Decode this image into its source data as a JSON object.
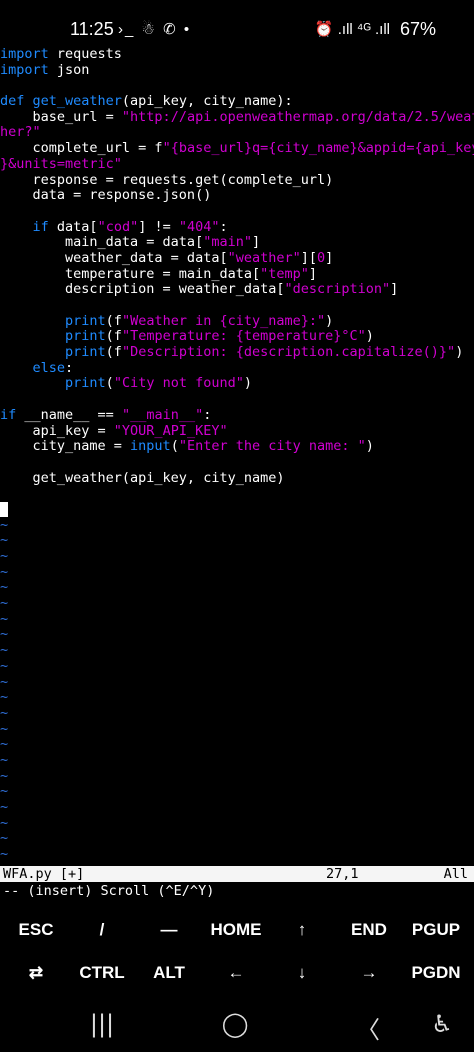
{
  "status_bar": {
    "time": "11:25",
    "left_icons": "›_ ☃ ✆ •",
    "right_icons": "⏰ .ıll ⁴ᴳ .ıll",
    "battery": "67%"
  },
  "code_lines": [
    [
      {
        "c": "kw",
        "t": "import"
      },
      {
        "c": "pl",
        "t": " requests"
      }
    ],
    [
      {
        "c": "kw",
        "t": "import"
      },
      {
        "c": "pl",
        "t": " json"
      }
    ],
    [],
    [
      {
        "c": "kw",
        "t": "def "
      },
      {
        "c": "fn",
        "t": "get_weather"
      },
      {
        "c": "pl",
        "t": "(api_key, city_name):"
      }
    ],
    [
      {
        "c": "pl",
        "t": "    base_url = "
      },
      {
        "c": "str",
        "t": "\"http://api.openweathermap.org/data/2.5/weat"
      }
    ],
    [
      {
        "c": "str",
        "t": "her?\""
      }
    ],
    [
      {
        "c": "pl",
        "t": "    complete_url = f"
      },
      {
        "c": "str",
        "t": "\"{base_url}q={city_name}&appid={api_key"
      }
    ],
    [
      {
        "c": "str",
        "t": "}&units=metric\""
      }
    ],
    [
      {
        "c": "pl",
        "t": "    response = requests.get(complete_url)"
      }
    ],
    [
      {
        "c": "pl",
        "t": "    data = response.json()"
      }
    ],
    [],
    [
      {
        "c": "pl",
        "t": "    "
      },
      {
        "c": "kw",
        "t": "if"
      },
      {
        "c": "pl",
        "t": " data["
      },
      {
        "c": "str",
        "t": "\"cod\""
      },
      {
        "c": "pl",
        "t": "] != "
      },
      {
        "c": "str",
        "t": "\"404\""
      },
      {
        "c": "pl",
        "t": ":"
      }
    ],
    [
      {
        "c": "pl",
        "t": "        main_data = data["
      },
      {
        "c": "str",
        "t": "\"main\""
      },
      {
        "c": "pl",
        "t": "]"
      }
    ],
    [
      {
        "c": "pl",
        "t": "        weather_data = data["
      },
      {
        "c": "str",
        "t": "\"weather\""
      },
      {
        "c": "pl",
        "t": "]["
      },
      {
        "c": "str",
        "t": "0"
      },
      {
        "c": "pl",
        "t": "]"
      }
    ],
    [
      {
        "c": "pl",
        "t": "        temperature = main_data["
      },
      {
        "c": "str",
        "t": "\"temp\""
      },
      {
        "c": "pl",
        "t": "]"
      }
    ],
    [
      {
        "c": "pl",
        "t": "        description = weather_data["
      },
      {
        "c": "str",
        "t": "\"description\""
      },
      {
        "c": "pl",
        "t": "]"
      }
    ],
    [],
    [
      {
        "c": "pl",
        "t": "        "
      },
      {
        "c": "fn",
        "t": "print"
      },
      {
        "c": "pl",
        "t": "(f"
      },
      {
        "c": "str",
        "t": "\"Weather in {city_name}:\""
      },
      {
        "c": "pl",
        "t": ")"
      }
    ],
    [
      {
        "c": "pl",
        "t": "        "
      },
      {
        "c": "fn",
        "t": "print"
      },
      {
        "c": "pl",
        "t": "(f"
      },
      {
        "c": "str",
        "t": "\"Temperature: {temperature}°C\""
      },
      {
        "c": "pl",
        "t": ")"
      }
    ],
    [
      {
        "c": "pl",
        "t": "        "
      },
      {
        "c": "fn",
        "t": "print"
      },
      {
        "c": "pl",
        "t": "(f"
      },
      {
        "c": "str",
        "t": "\"Description: {description.capitalize()}\""
      },
      {
        "c": "pl",
        "t": ")"
      }
    ],
    [
      {
        "c": "pl",
        "t": "    "
      },
      {
        "c": "kw",
        "t": "else"
      },
      {
        "c": "pl",
        "t": ":"
      }
    ],
    [
      {
        "c": "pl",
        "t": "        "
      },
      {
        "c": "fn",
        "t": "print"
      },
      {
        "c": "pl",
        "t": "("
      },
      {
        "c": "str",
        "t": "\"City not found\""
      },
      {
        "c": "pl",
        "t": ")"
      }
    ],
    [],
    [
      {
        "c": "kw",
        "t": "if"
      },
      {
        "c": "pl",
        "t": " __name__ == "
      },
      {
        "c": "str",
        "t": "\"__main__\""
      },
      {
        "c": "pl",
        "t": ":"
      }
    ],
    [
      {
        "c": "pl",
        "t": "    api_key = "
      },
      {
        "c": "str",
        "t": "\"YOUR_API_KEY\""
      }
    ],
    [
      {
        "c": "pl",
        "t": "    city_name = "
      },
      {
        "c": "fn",
        "t": "input"
      },
      {
        "c": "pl",
        "t": "("
      },
      {
        "c": "str",
        "t": "\"Enter the city name: \""
      },
      {
        "c": "pl",
        "t": ")"
      }
    ],
    [],
    [
      {
        "c": "pl",
        "t": "    get_weather(api_key, city_name)"
      }
    ],
    [],
    [
      {
        "c": "cursor",
        "t": ""
      }
    ]
  ],
  "tilde_char": "~",
  "tilde_count": 23,
  "vim_status": {
    "filename": "WFA.py [+]",
    "position": "27,1",
    "percent": "All",
    "mode": "-- (insert) Scroll (^E/^Y)"
  },
  "keys_row1": [
    "ESC",
    "/",
    "—",
    "HOME",
    "↑",
    "END",
    "PGUP"
  ],
  "keys_row2": [
    "⇄",
    "CTRL",
    "ALT",
    "←",
    "↓",
    "→",
    "PGDN"
  ],
  "navbar": {
    "recents": "|||",
    "home": "◯",
    "back": "〈",
    "accessibility": "♿"
  }
}
